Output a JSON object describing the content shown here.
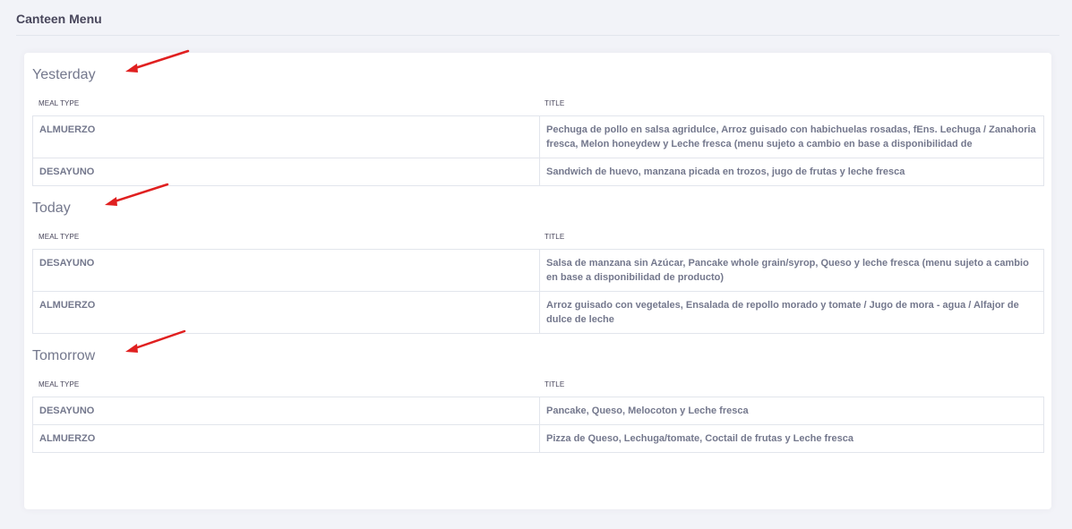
{
  "page": {
    "title": "Canteen Menu"
  },
  "columns": {
    "meal_type": "MEAL TYPE",
    "title": "TITLE"
  },
  "colors": {
    "arrow": "#e02020",
    "background": "#f2f3f8",
    "card": "#ffffff",
    "text": "#74788d"
  },
  "sections": [
    {
      "heading": "Yesterday",
      "rows": [
        {
          "meal_type": "ALMUERZO",
          "title": "Pechuga de pollo en salsa agridulce, Arroz guisado con habichuelas rosadas, fEns. Lechuga / Zanahoria fresca, Melon honeydew y Leche fresca (menu sujeto a cambio en base a disponibilidad de"
        },
        {
          "meal_type": "DESAYUNO",
          "title": "Sandwich de huevo, manzana picada en trozos, jugo de frutas y leche fresca"
        }
      ]
    },
    {
      "heading": "Today",
      "rows": [
        {
          "meal_type": "DESAYUNO",
          "title": "Salsa de manzana sin Azúcar, Pancake whole grain/syrop, Queso y leche fresca (menu sujeto a cambio en base a disponibilidad de producto)"
        },
        {
          "meal_type": "ALMUERZO",
          "title": "Arroz guisado con vegetales, Ensalada de repollo morado y tomate / Jugo de mora - agua / Alfajor de dulce de leche"
        }
      ]
    },
    {
      "heading": "Tomorrow",
      "rows": [
        {
          "meal_type": "DESAYUNO",
          "title": "Pancake, Queso, Melocoton y Leche fresca"
        },
        {
          "meal_type": "ALMUERZO",
          "title": "Pizza de Queso, Lechuga/tomate, Coctail de frutas y Leche fresca"
        }
      ]
    }
  ]
}
